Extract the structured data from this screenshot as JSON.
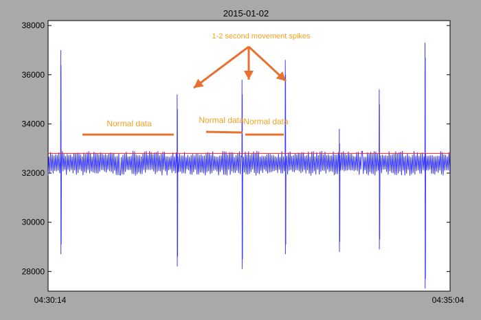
{
  "chart_data": {
    "type": "line",
    "title": "2015-01-02",
    "xlabel": "",
    "ylabel": "",
    "x_tick_labels": [
      "04:30:14",
      "04:35:04"
    ],
    "x_range": [
      "04:30:14",
      "04:35:04"
    ],
    "ylim": [
      27200,
      38200
    ],
    "y_ticks": [
      28000,
      30000,
      32000,
      34000,
      36000,
      38000
    ],
    "grid": false,
    "series": [
      {
        "color": "#3a3aff",
        "baseline": 32400,
        "oscillation_low": 31900,
        "oscillation_high": 32900,
        "spikes": [
          {
            "time": "04:30:23",
            "high": 37000,
            "low": 28700
          },
          {
            "time": "04:31:47",
            "high": 35200,
            "low": 28200
          },
          {
            "time": "04:32:34",
            "high": 35800,
            "low": 28100
          },
          {
            "time": "04:33:05",
            "high": 36600,
            "low": 28700
          },
          {
            "time": "04:33:44",
            "high": 33800,
            "low": 28800
          },
          {
            "time": "04:34:13",
            "high": 35400,
            "low": 28900
          },
          {
            "time": "04:34:46",
            "high": 37300,
            "low": 27300
          }
        ]
      },
      {
        "color": "#ff2020",
        "value": 32800
      }
    ],
    "annotations": {
      "arrow_title": "1-2 second movement spikes",
      "normal_labels": [
        "Normal data",
        "Normal data",
        "Normal data"
      ],
      "color": "#f5a020",
      "line_color": "#e87030"
    }
  }
}
